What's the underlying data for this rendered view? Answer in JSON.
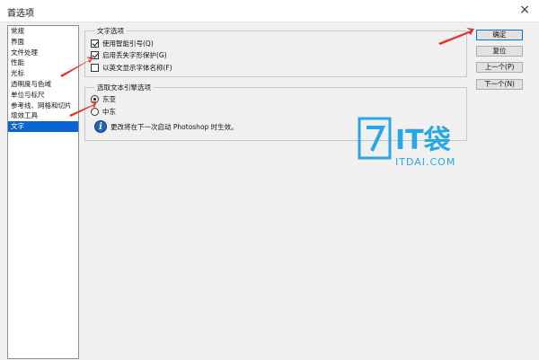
{
  "window": {
    "title": "首选项",
    "close_symbol": "×"
  },
  "nav": {
    "items": [
      {
        "label": "常规"
      },
      {
        "label": "界面"
      },
      {
        "label": "文件处理"
      },
      {
        "label": "性能"
      },
      {
        "label": "光标"
      },
      {
        "label": "透明度与色域"
      },
      {
        "label": "单位与标尺"
      },
      {
        "label": "参考线、网格和切片"
      },
      {
        "label": "增效工具"
      },
      {
        "label": "文字",
        "selected": true
      }
    ]
  },
  "text_options": {
    "legend": "文字选项",
    "smart_quotes": {
      "label": "使用智能引号(Q)",
      "checked": true
    },
    "missing_glyph": {
      "label": "启用丢失字形保护(G)",
      "checked": true
    },
    "english_font_names": {
      "label": "以英文显示字体名称(F)",
      "checked": false
    }
  },
  "text_engine": {
    "legend": "选取文本引擎选项",
    "east_asian": {
      "label": "东亚",
      "selected": true
    },
    "middle_east": {
      "label": "中东",
      "selected": false
    },
    "info_text": "更改将在下一次启动 Photoshop 时生效。"
  },
  "buttons": {
    "ok": "确定",
    "reset": "复位",
    "prev": "上一个(P)",
    "next": "下一个(N)"
  },
  "watermark": {
    "brand": "IT袋",
    "domain": "ITDAI.COM"
  },
  "colors": {
    "accent": "#0a64d6",
    "arrow": "#e5322d",
    "watermark": "#27a7e6"
  }
}
